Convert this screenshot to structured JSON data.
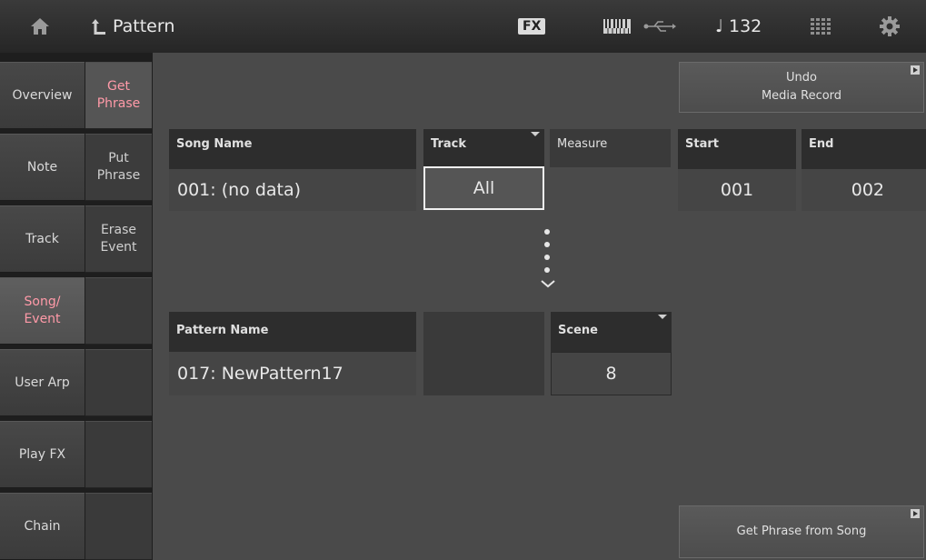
{
  "header": {
    "title": "Pattern",
    "fx_label": "FX",
    "tempo_label": "♩ 132"
  },
  "main_tabs": [
    {
      "label": "Overview"
    },
    {
      "label": "Note"
    },
    {
      "label": "Track"
    },
    {
      "label": "Song/\nEvent"
    },
    {
      "label": "User Arp"
    },
    {
      "label": "Play FX"
    },
    {
      "label": "Chain"
    }
  ],
  "sub_tabs": [
    {
      "label": "Get\nPhrase"
    },
    {
      "label": "Put\nPhrase"
    },
    {
      "label": "Erase\nEvent"
    }
  ],
  "song": {
    "name_header": "Song Name",
    "name_value": "001: (no data)",
    "track_header": "Track",
    "track_value": "All",
    "measure_header": "Measure",
    "start_header": "Start",
    "start_value": "001",
    "end_header": "End",
    "end_value": "002"
  },
  "pattern": {
    "name_header": "Pattern Name",
    "name_value": "017: NewPattern17",
    "scene_header": "Scene",
    "scene_value": "8"
  },
  "buttons": {
    "undo_label": "Undo\nMedia Record",
    "get_phrase_label": "Get Phrase from Song"
  },
  "colors": {
    "accent": "#ff9aa8"
  }
}
